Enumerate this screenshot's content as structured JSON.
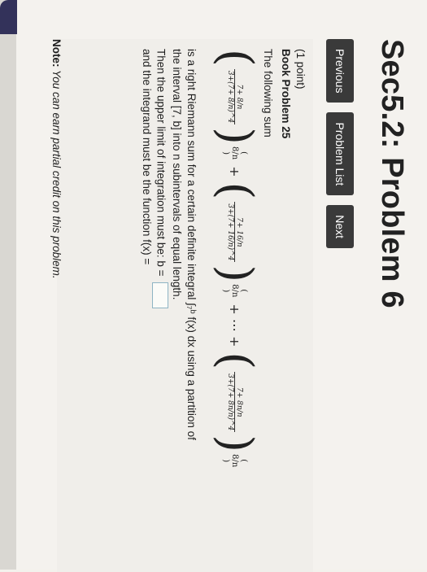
{
  "page": {
    "title": "Sec5.2: Problem 6"
  },
  "nav": {
    "previous_label": "Previous",
    "problem_list_label": "Problem List",
    "next_label": "Next"
  },
  "problem": {
    "points": "(1 point)",
    "book_problem": "Book Problem 25",
    "intro": "The following sum",
    "sum_terms": {
      "term1_numerator": "7+ 8/n",
      "term1_denominator": "3+(7+ 8/n)^4",
      "term2_numerator": "7+ 16/n",
      "term2_denominator": "3+(7+ 16/n)^4",
      "termN_numerator": "7+ 8n/n",
      "termN_denominator": "3+(7+ 8n/n)^4",
      "delta": "8/n",
      "plus": "+",
      "ellipsis": "+ ⋯ +"
    },
    "line1": "is a right Riemann sum for a certain definite integral ∫₇ᵇ f(x) dx using a partition of",
    "line2": "the interval [7, b] into n subintervals of equal length.",
    "line3": "Then the upper limit of integration must be: b =",
    "line4": "and the integrand must be the function f(x) =",
    "answer_b": ""
  },
  "note": {
    "label": "Note:",
    "text": "You can earn partial credit on this problem."
  }
}
